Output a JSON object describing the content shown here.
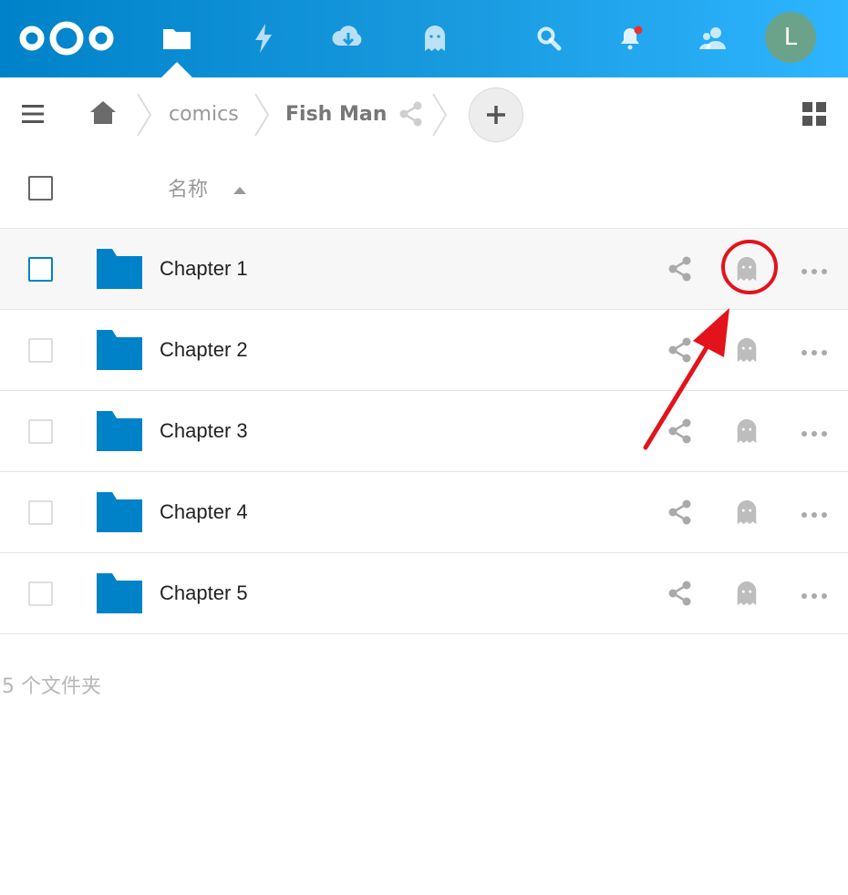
{
  "header": {
    "logo": "nextcloud-logo",
    "nav": [
      {
        "name": "files-icon",
        "active": true
      },
      {
        "name": "activity-icon"
      },
      {
        "name": "cloud-download-icon"
      },
      {
        "name": "ghost-app-icon"
      }
    ],
    "search_icon": "search-icon",
    "notifications_icon": "bell-icon",
    "contacts_icon": "contacts-icon",
    "avatar_letter": "L",
    "avatar_color": "#6aa38a",
    "notification_dot_color": "#e9322d"
  },
  "breadcrumb": {
    "items": [
      {
        "label": "comics"
      },
      {
        "label": "Fish Man"
      }
    ]
  },
  "columns": {
    "name_header": "名称"
  },
  "rows": [
    {
      "name": "Chapter 1"
    },
    {
      "name": "Chapter 2"
    },
    {
      "name": "Chapter 3"
    },
    {
      "name": "Chapter 4"
    },
    {
      "name": "Chapter 5"
    }
  ],
  "summary": "5 个文件夹",
  "colors": {
    "accent": "#0082c9",
    "folder": "#0082c9",
    "annotation": "#e3131b"
  }
}
